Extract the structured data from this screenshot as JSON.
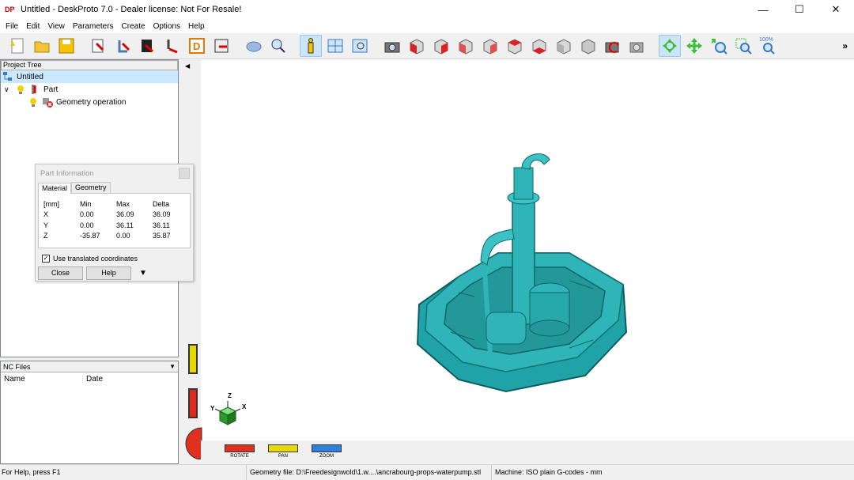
{
  "window": {
    "title": "Untitled - DeskProto 7.0 - Dealer license: Not For Resale!",
    "app_icon": "DP"
  },
  "menu": [
    "File",
    "Edit",
    "View",
    "Parameters",
    "Create",
    "Options",
    "Help"
  ],
  "toolbar": {
    "icons": [
      "new-icon",
      "open-icon",
      "save-icon",
      "part-wizard-icon",
      "multi-axis-wizard-icon",
      "image-wizard-icon",
      "wizard-icon",
      "drawing-icon",
      "export-icon",
      "object-icon",
      "zoom-icon",
      "info-icon",
      "layout-icon",
      "preview-icon",
      "camera-icon",
      "view-front-icon",
      "view-back-icon",
      "view-left-icon",
      "view-right-icon",
      "view-top-icon",
      "view-bottom-icon",
      "view-iso-icon",
      "view-iso2-icon",
      "view-reset-icon",
      "view-last-icon",
      "rotate-mode-icon",
      "pan-mode-icon",
      "zoom-mode-icon",
      "zoom-window-icon",
      "zoom-100-icon"
    ],
    "zoom100_label": "100%",
    "more": "»"
  },
  "project_tree": {
    "header": "Project Tree",
    "root": "Untitled",
    "part": "Part",
    "operation": "Geometry operation"
  },
  "nc_files": {
    "header": "NC Files",
    "col_name": "Name",
    "col_date": "Date"
  },
  "part_info": {
    "title": "Part Information",
    "tabs": [
      "Material",
      "Geometry"
    ],
    "headers": [
      "[mm]",
      "Min",
      "Max",
      "Delta"
    ],
    "rows": [
      [
        "X",
        "0.00",
        "36.09",
        "36.09"
      ],
      [
        "Y",
        "0.00",
        "36.11",
        "36.11"
      ],
      [
        "Z",
        "-35.87",
        "0.00",
        "35.87"
      ]
    ],
    "checkbox_label": "Use translated coordinates",
    "checked": true,
    "close_label": "Close",
    "help_label": "Help"
  },
  "viewport": {
    "model_color": "#2fb5b8",
    "axis_x": "X",
    "axis_y": "Y",
    "axis_z": "Z",
    "rotate_label": "ROTATE",
    "pan_label": "PAN",
    "zoom_label": "ZOOM"
  },
  "status": {
    "help": "For Help, press F1",
    "geometry": "Geometry file: D:\\Freedesignwold\\1.w....\\ancrabourg-props-waterpump.stl",
    "machine": "Machine: ISO plain G-codes - mm"
  }
}
